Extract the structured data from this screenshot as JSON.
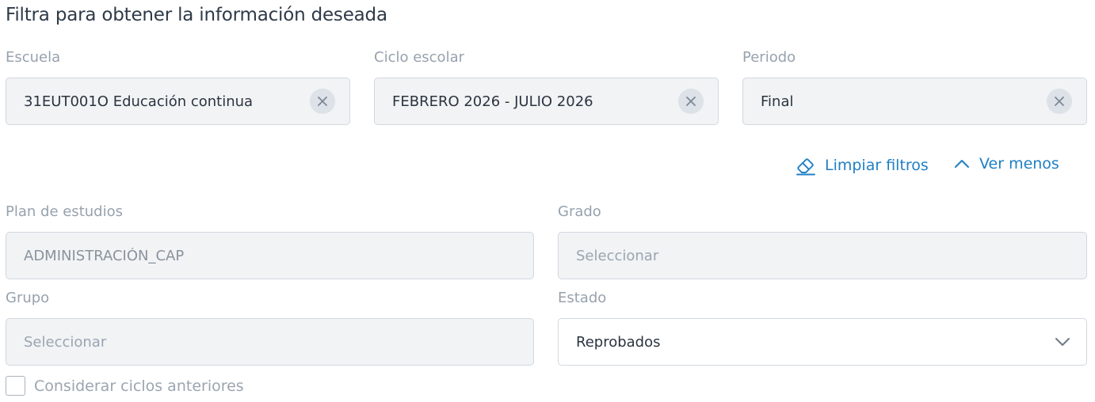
{
  "title": "Filtra para obtener la información deseada",
  "filters": {
    "escuela": {
      "label": "Escuela",
      "value": "31EUT001O Educación continua"
    },
    "ciclo": {
      "label": "Ciclo escolar",
      "value": "FEBRERO 2026 - JULIO 2026"
    },
    "periodo": {
      "label": "Periodo",
      "value": "Final"
    },
    "plan": {
      "label": "Plan de estudios",
      "value": "ADMINISTRACIÓN_CAP"
    },
    "grado": {
      "label": "Grado",
      "placeholder": "Seleccionar"
    },
    "grupo": {
      "label": "Grupo",
      "placeholder": "Seleccionar"
    },
    "estado": {
      "label": "Estado",
      "value": "Reprobados"
    }
  },
  "actions": {
    "clear": "Limpiar filtros",
    "less": "Ver menos"
  },
  "checkbox": {
    "label": "Considerar ciclos anteriores",
    "checked": false
  },
  "colors": {
    "accent": "#1f7fc4",
    "field_bg": "#f1f3f5",
    "label": "#97a2ae"
  }
}
